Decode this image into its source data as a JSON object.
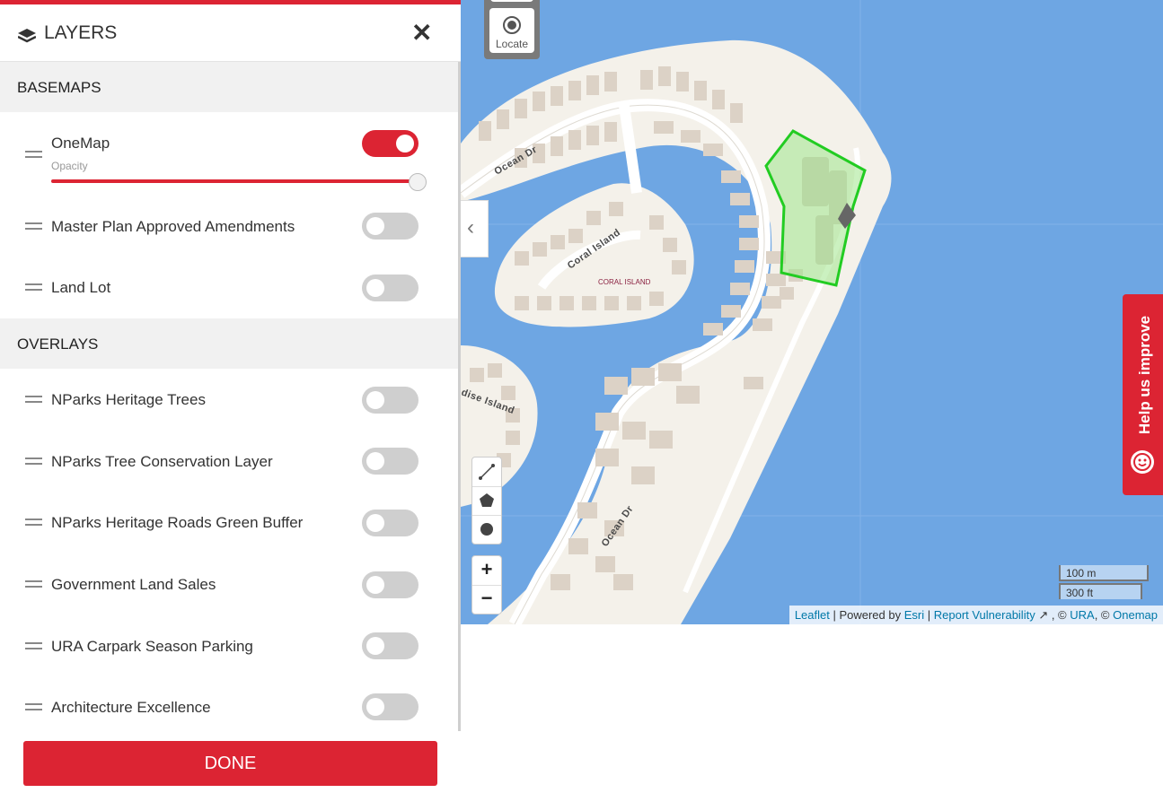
{
  "panel": {
    "title": "LAYERS",
    "done_label": "DONE",
    "basemaps_heading": "BASEMAPS",
    "overlays_heading": "OVERLAYS",
    "opacity_label": "Opacity",
    "opacity_value": 1.0,
    "basemaps": [
      {
        "label": "OneMap",
        "enabled": true
      },
      {
        "label": "Master Plan Approved Amendments",
        "enabled": false
      },
      {
        "label": "Land Lot",
        "enabled": false
      }
    ],
    "overlays": [
      {
        "label": "NParks Heritage Trees",
        "enabled": false
      },
      {
        "label": "NParks Tree Conservation Layer",
        "enabled": false
      },
      {
        "label": "NParks Heritage Roads Green Buffer",
        "enabled": false
      },
      {
        "label": "Government Land Sales",
        "enabled": false
      },
      {
        "label": "URA Carpark Season Parking",
        "enabled": false
      },
      {
        "label": "Architecture Excellence",
        "enabled": false
      }
    ],
    "accent_color": "#dc2433"
  },
  "map": {
    "locate_label": "Locate",
    "road_labels": [
      "Ocean Dr",
      "Coral Island",
      "dise Island",
      "Ocean Dr"
    ],
    "place_label": "CORAL ISLAND",
    "scale_metric": "100 m",
    "scale_imperial": "300 ft",
    "help_tab_label": "Help us improve",
    "zoom_in": "+",
    "zoom_out": "−",
    "draw_tools": [
      "line-tool-icon",
      "polygon-tool-icon",
      "circle-tool-icon"
    ],
    "water_color": "#6ea6e3",
    "land_color": "#f4f1ea",
    "selection_color": "#22cc22",
    "attribution": {
      "leaflet": "Leaflet",
      "sep1": " | Powered by ",
      "esri": "Esri",
      "sep2": " | ",
      "report": "Report Vulnerability",
      "sep3": " , © ",
      "ura": "URA",
      "sep4": ", © ",
      "onemap": "Onemap"
    }
  }
}
